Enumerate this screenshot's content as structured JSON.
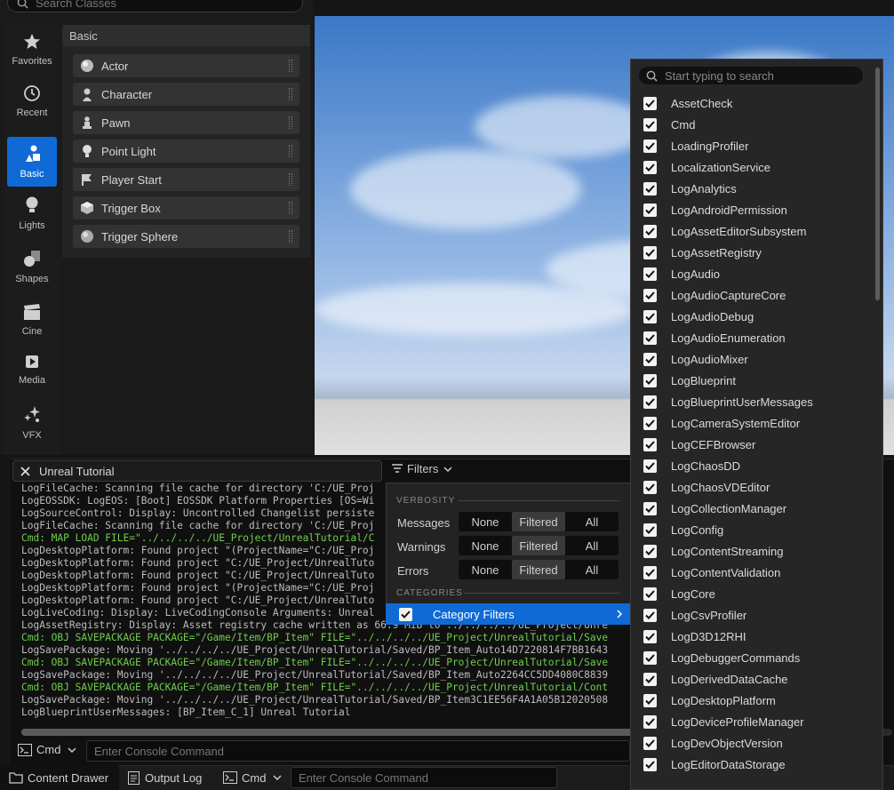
{
  "place_actors": {
    "search_placeholder": "Search Classes",
    "list_header": "Basic",
    "categories": [
      {
        "label": "Favorites",
        "icon": "star-icon"
      },
      {
        "label": "Recent",
        "icon": "clock-icon"
      },
      {
        "label": "Basic",
        "icon": "basic-shapes-icon",
        "active": true
      },
      {
        "label": "Lights",
        "icon": "lightbulb-icon"
      },
      {
        "label": "Shapes",
        "icon": "shapes-icon"
      },
      {
        "label": "Cine",
        "icon": "clapperboard-icon"
      },
      {
        "label": "Media",
        "icon": "media-icon"
      },
      {
        "label": "VFX",
        "icon": "sparkle-icon"
      }
    ],
    "items": [
      {
        "label": "Actor",
        "icon": "sphere-icon"
      },
      {
        "label": "Character",
        "icon": "character-icon"
      },
      {
        "label": "Pawn",
        "icon": "pawn-icon"
      },
      {
        "label": "Point Light",
        "icon": "point-light-icon"
      },
      {
        "label": "Player Start",
        "icon": "flag-icon"
      },
      {
        "label": "Trigger Box",
        "icon": "cube-icon"
      },
      {
        "label": "Trigger Sphere",
        "icon": "sphere-icon"
      }
    ]
  },
  "output_log": {
    "tab_title": "Unreal Tutorial",
    "filters_label": "Filters",
    "lines": [
      {
        "text": "LogFileCache: Scanning file cache for directory 'C:/UE_Proj",
        "green": false
      },
      {
        "text": "LogEOSSDK: LogEOS: [Boot] EOSSDK Platform Properties [OS=Wi",
        "green": false
      },
      {
        "text": "LogSourceControl: Display: Uncontrolled Changelist persiste",
        "green": false
      },
      {
        "text": "LogFileCache: Scanning file cache for directory 'C:/UE_Proj",
        "green": false
      },
      {
        "text": "Cmd: MAP LOAD FILE=\"../../../../UE_Project/UnrealTutorial/C",
        "green": true
      },
      {
        "text": "LogDesktopPlatform: Found project \"(ProjectName=\"C:/UE_Proj",
        "green": false
      },
      {
        "text": "LogDesktopPlatform: Found project \"C:/UE_Project/UnrealTuto",
        "green": false
      },
      {
        "text": "LogDesktopPlatform: Found project \"C:/UE_Project/UnrealTuto",
        "green": false
      },
      {
        "text": "LogDesktopPlatform: Found project \"(ProjectName=\"C:/UE_Proj",
        "green": false
      },
      {
        "text": "LogDesktopPlatform: Found project \"C:/UE_Project/UnrealTuto",
        "green": false
      },
      {
        "text": "LogLiveCoding: Display: LiveCodingConsole Arguments: Unreal",
        "green": false
      },
      {
        "text": "LogAssetRegistry: Display: Asset registry cache written as 66.9 MiB to ../../../../UE_Project/Unre",
        "green": false
      },
      {
        "text": "Cmd: OBJ SAVEPACKAGE PACKAGE=\"/Game/Item/BP_Item\" FILE=\"../../../../UE_Project/UnrealTutorial/Save",
        "green": true
      },
      {
        "text": "LogSavePackage: Moving '../../../../UE_Project/UnrealTutorial/Saved/BP_Item_Auto14D7220814F7BB1643",
        "green": false
      },
      {
        "text": "Cmd: OBJ SAVEPACKAGE PACKAGE=\"/Game/Item/BP_Item\" FILE=\"../../../../UE_Project/UnrealTutorial/Save",
        "green": true
      },
      {
        "text": "LogSavePackage: Moving '../../../../UE_Project/UnrealTutorial/Saved/BP_Item_Auto2264CC5DD4080C8839",
        "green": false
      },
      {
        "text": "Cmd: OBJ SAVEPACKAGE PACKAGE=\"/Game/Item/BP_Item\" FILE=\"../../../../UE_Project/UnrealTutorial/Cont",
        "green": true
      },
      {
        "text": "LogSavePackage: Moving '../../../../UE_Project/UnrealTutorial/Saved/BP_Item3C1EE56F4A1A05B12020508",
        "green": false
      },
      {
        "text": "LogBlueprintUserMessages: [BP_Item_C_1] Unreal Tutorial",
        "green": false
      }
    ],
    "cmd_label": "Cmd",
    "console_placeholder": "Enter Console Command"
  },
  "filter_menu": {
    "verbosity_header": "VERBOSITY",
    "categories_header": "CATEGORIES",
    "rows": [
      {
        "label": "Messages",
        "options": [
          "None",
          "Filtered",
          "All"
        ],
        "selected": "Filtered"
      },
      {
        "label": "Warnings",
        "options": [
          "None",
          "Filtered",
          "All"
        ],
        "selected": "Filtered"
      },
      {
        "label": "Errors",
        "options": [
          "None",
          "Filtered",
          "All"
        ],
        "selected": "Filtered"
      }
    ],
    "category_filters_label": "Category Filters"
  },
  "category_submenu": {
    "search_placeholder": "Start typing to search",
    "items": [
      "AssetCheck",
      "Cmd",
      "LoadingProfiler",
      "LocalizationService",
      "LogAnalytics",
      "LogAndroidPermission",
      "LogAssetEditorSubsystem",
      "LogAssetRegistry",
      "LogAudio",
      "LogAudioCaptureCore",
      "LogAudioDebug",
      "LogAudioEnumeration",
      "LogAudioMixer",
      "LogBlueprint",
      "LogBlueprintUserMessages",
      "LogCameraSystemEditor",
      "LogCEFBrowser",
      "LogChaosDD",
      "LogChaosVDEditor",
      "LogCollectionManager",
      "LogConfig",
      "LogContentStreaming",
      "LogContentValidation",
      "LogCore",
      "LogCsvProfiler",
      "LogD3D12RHI",
      "LogDebuggerCommands",
      "LogDerivedDataCache",
      "LogDesktopPlatform",
      "LogDeviceProfileManager",
      "LogDevObjectVersion",
      "LogEditorDataStorage"
    ]
  },
  "bottom_bar": {
    "content_drawer": "Content Drawer",
    "output_log": "Output Log",
    "cmd": "Cmd",
    "console_placeholder": "Enter Console Command"
  },
  "colors": {
    "accent": "#0f6ad6",
    "log_green": "#6ecf4c"
  }
}
